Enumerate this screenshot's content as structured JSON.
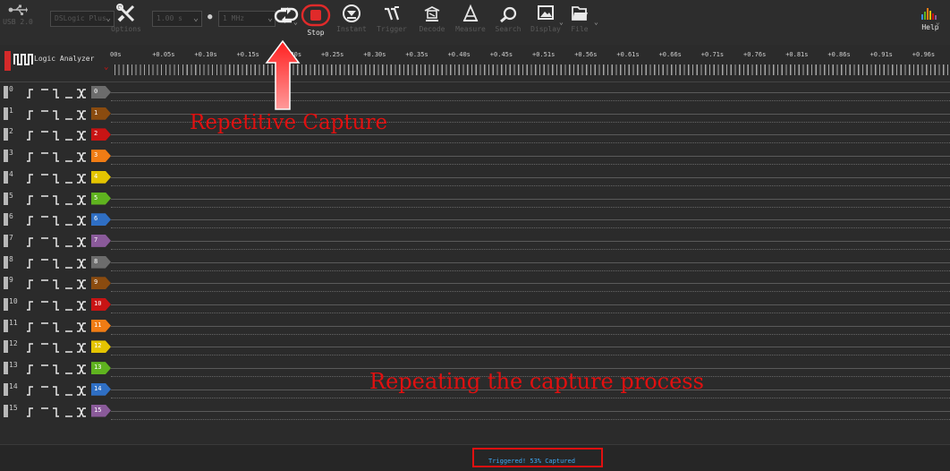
{
  "toolbar": {
    "usb": {
      "label": "USB 2.0"
    },
    "device_combo": "DSLogic Plus",
    "options_label": "Options",
    "duration_combo": "1.00 s",
    "rate_combo": "1 MHz",
    "buttons": {
      "stop": "Stop",
      "instant": "Instant",
      "trigger": "Trigger",
      "decode": "Decode",
      "measure": "Measure",
      "search": "Search",
      "display": "Display",
      "file": "File",
      "help": "Help"
    }
  },
  "ruler": {
    "title": "Logic Analyzer",
    "ticks": [
      "00s",
      "+0.05s",
      "+0.10s",
      "+0.15s",
      "+0.20s",
      "+0.25s",
      "+0.30s",
      "+0.35s",
      "+0.40s",
      "+0.45s",
      "+0.51s",
      "+0.56s",
      "+0.61s",
      "+0.66s",
      "+0.71s",
      "+0.76s",
      "+0.81s",
      "+0.86s",
      "+0.91s",
      "+0.96s"
    ]
  },
  "channels": [
    {
      "num": "0",
      "color": "#6c6c6c"
    },
    {
      "num": "1",
      "color": "#8a4b0f"
    },
    {
      "num": "2",
      "color": "#c81414"
    },
    {
      "num": "3",
      "color": "#f07c14"
    },
    {
      "num": "4",
      "color": "#e4c400"
    },
    {
      "num": "5",
      "color": "#5fb31f"
    },
    {
      "num": "6",
      "color": "#2f6fc4"
    },
    {
      "num": "7",
      "color": "#8a5a9a"
    },
    {
      "num": "8",
      "color": "#6c6c6c"
    },
    {
      "num": "9",
      "color": "#8a4b0f"
    },
    {
      "num": "10",
      "color": "#c81414"
    },
    {
      "num": "11",
      "color": "#f07c14"
    },
    {
      "num": "12",
      "color": "#e4c400"
    },
    {
      "num": "13",
      "color": "#5fb31f"
    },
    {
      "num": "14",
      "color": "#2f6fc4"
    },
    {
      "num": "15",
      "color": "#8a5a9a"
    }
  ],
  "status": {
    "text": "Triggered! 53% Captured"
  },
  "annotations": {
    "repetitive": "Repetitive Capture",
    "repeating": "Repeating the capture process"
  }
}
